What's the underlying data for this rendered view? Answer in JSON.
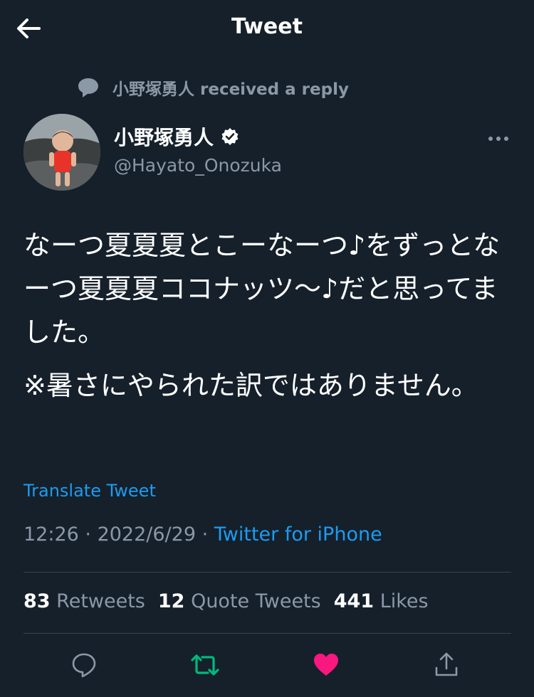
{
  "header": {
    "title": "Tweet"
  },
  "reply_notice": {
    "text": "小野塚勇人 received a reply"
  },
  "user": {
    "name": "小野塚勇人",
    "handle": "@Hayato_Onozuka"
  },
  "tweet": {
    "paragraph1": "なーつ夏夏夏とこーなーつ♪をずっとなーつ夏夏夏ココナッツ〜♪だと思ってました。",
    "paragraph2": "※暑さにやられた訳ではありません。"
  },
  "translate_label": "Translate Tweet",
  "meta": {
    "time": "12:26",
    "sep1": " · ",
    "date": "2022/6/29",
    "sep2": " · ",
    "source": "Twitter for iPhone"
  },
  "stats": {
    "retweets_count": "83",
    "retweets_label": "Retweets",
    "quotes_count": "12",
    "quotes_label": "Quote Tweets",
    "likes_count": "441",
    "likes_label": "Likes"
  },
  "colors": {
    "background": "#15202b",
    "accent": "#1d9bf0",
    "retweet": "#00ba7c",
    "like": "#f91880",
    "muted": "#8b98a5"
  },
  "icons": [
    "arrow-left-icon",
    "reply-bubble-icon",
    "verified-badge-icon",
    "more-horizontal-icon",
    "reply-icon",
    "retweet-icon",
    "heart-icon",
    "share-icon"
  ],
  "actions": {
    "liked": true,
    "retweeted": true
  }
}
